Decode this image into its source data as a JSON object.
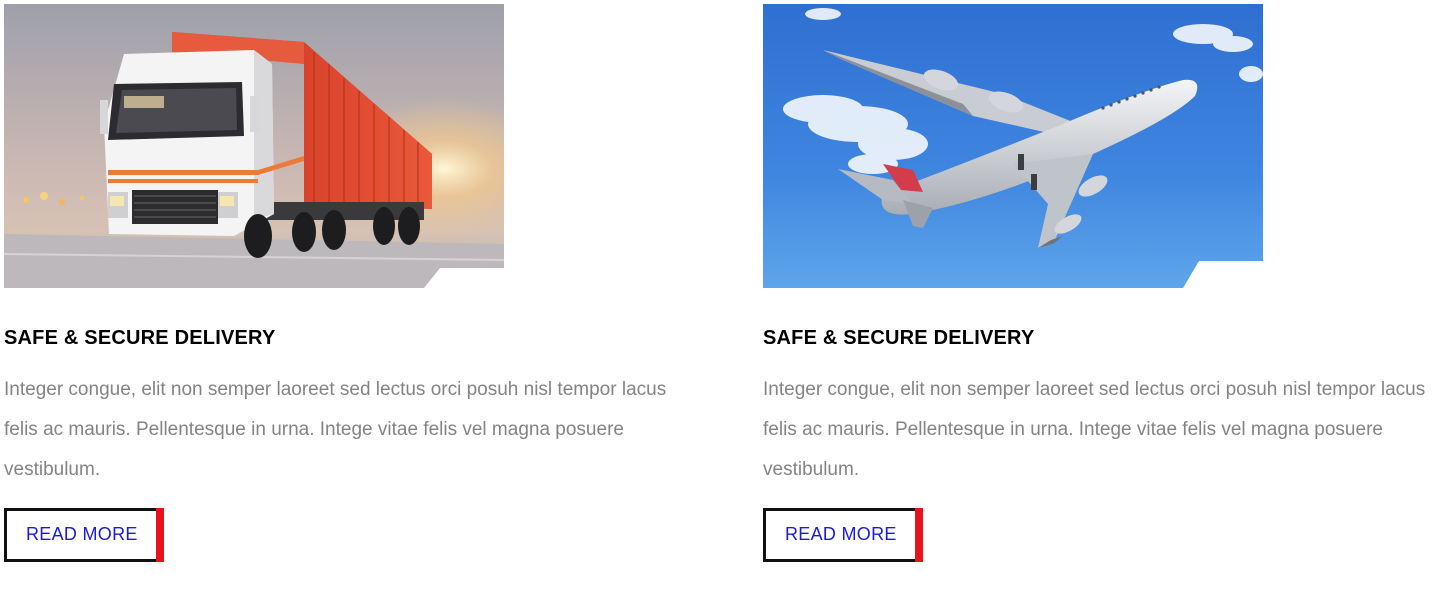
{
  "colors": {
    "title": "#000000",
    "body_text": "#848484",
    "button_text": "#1a1ae6",
    "button_border": "#111111",
    "button_accent": "#e8141c"
  },
  "cards": [
    {
      "image_icon": "cargo-truck-photo",
      "title": "SAFE & SECURE DELIVERY",
      "body": "Integer congue, elit non semper laoreet sed lectus orci posuh nisl tempor lacus felis ac mauris. Pellentesque in urna. Intege vitae felis vel magna posuere vestibulum.",
      "button_label": "READ MORE"
    },
    {
      "image_icon": "airplane-photo",
      "title": "SAFE & SECURE DELIVERY",
      "body": "Integer congue, elit non semper laoreet sed lectus orci posuh nisl tempor lacus felis ac mauris. Pellentesque in urna. Intege vitae felis vel magna posuere vestibulum.",
      "button_label": "READ MORE"
    }
  ]
}
